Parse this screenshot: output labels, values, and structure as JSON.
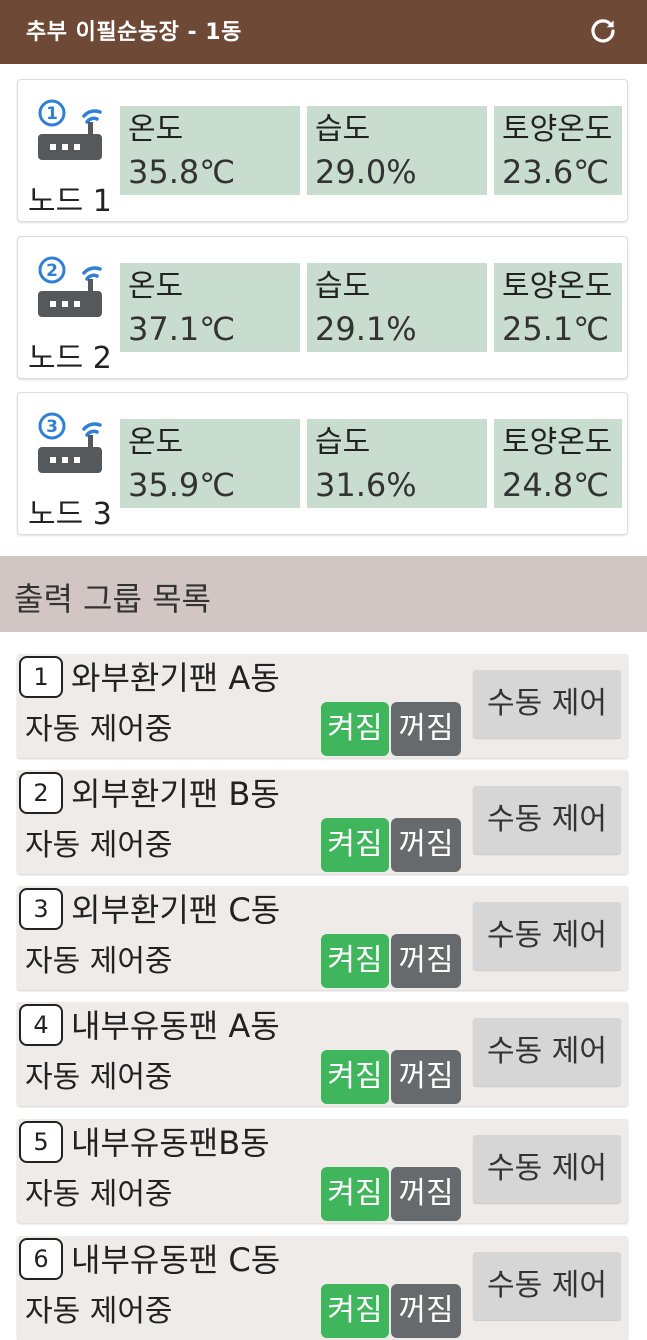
{
  "header": {
    "title": "추부 이필순농장 - 1동",
    "refresh_icon": "refresh-icon"
  },
  "nodes": [
    {
      "badge": "1",
      "label": "노드 1",
      "temp_label": "온도",
      "temp": "35.8℃",
      "humid_label": "습도",
      "humid": "29.0%",
      "soil_label": "토양온도",
      "soil": "23.6℃"
    },
    {
      "badge": "2",
      "label": "노드 2",
      "temp_label": "온도",
      "temp": "37.1℃",
      "humid_label": "습도",
      "humid": "29.1%",
      "soil_label": "토양온도",
      "soil": "25.1℃"
    },
    {
      "badge": "3",
      "label": "노드 3",
      "temp_label": "온도",
      "temp": "35.9℃",
      "humid_label": "습도",
      "humid": "31.6%",
      "soil_label": "토양온도",
      "soil": "24.8℃"
    }
  ],
  "output_section": {
    "title": "출력 그룹 목록"
  },
  "groups": [
    {
      "num": "1",
      "name": "와부환기팬 A동",
      "mode": "자동 제어중",
      "on": "켜짐",
      "off": "꺼짐",
      "manual": "수동 제어"
    },
    {
      "num": "2",
      "name": "외부환기팬 B동",
      "mode": "자동 제어중",
      "on": "켜짐",
      "off": "꺼짐",
      "manual": "수동 제어"
    },
    {
      "num": "3",
      "name": "외부환기팬 C동",
      "mode": "자동 제어중",
      "on": "켜짐",
      "off": "꺼짐",
      "manual": "수동 제어"
    },
    {
      "num": "4",
      "name": "내부유동팬 A동",
      "mode": "자동 제어중",
      "on": "켜짐",
      "off": "꺼짐",
      "manual": "수동 제어"
    },
    {
      "num": "5",
      "name": "내부유동팬B동",
      "mode": "자동 제어중",
      "on": "켜짐",
      "off": "꺼짐",
      "manual": "수동 제어"
    },
    {
      "num": "6",
      "name": "내부유동팬 C동",
      "mode": "자동 제어중",
      "on": "켜짐",
      "off": "꺼짐",
      "manual": "수동 제어"
    }
  ],
  "colors": {
    "appbar": "#6e4a36",
    "sensor_cell": "#c8ddd0",
    "section": "#d1c6c3",
    "on": "#3fb55c",
    "off": "#666a6d",
    "wifi": "#2f7fd6"
  }
}
